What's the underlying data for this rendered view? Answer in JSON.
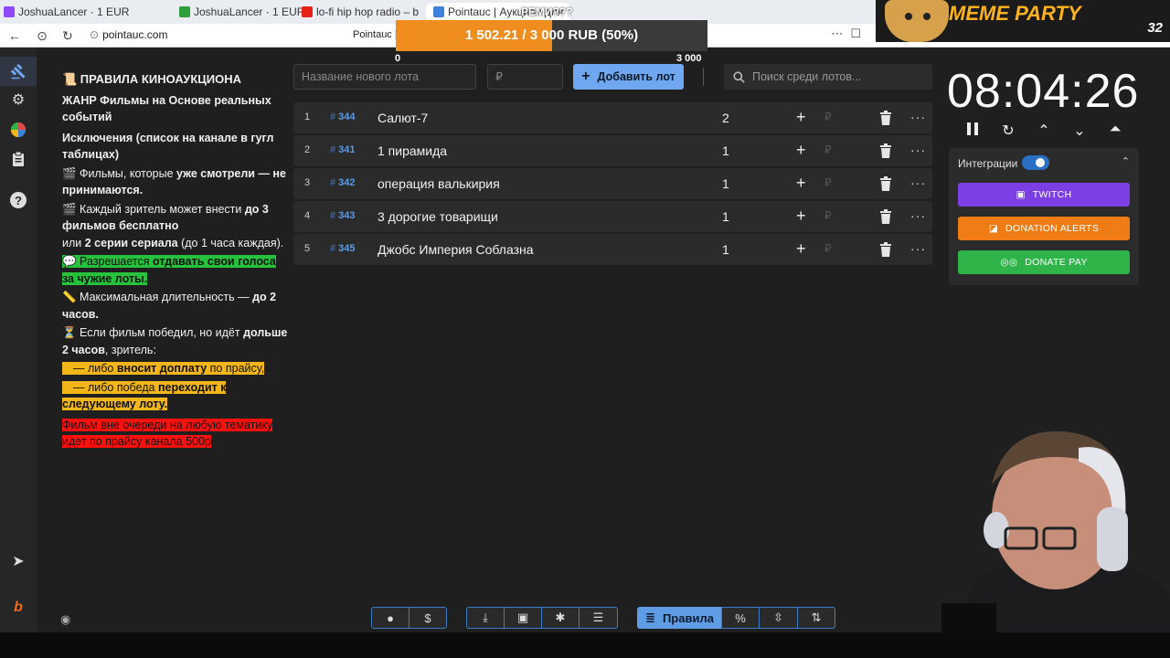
{
  "browser": {
    "tabs": [
      {
        "label": "JoshuaLancer · 1 EUR"
      },
      {
        "label": "JoshuaLancer · 1 EUR"
      },
      {
        "label": "lo-fi hip hop radio – b"
      },
      {
        "label": "Pointauc | Аукцион для"
      }
    ],
    "url": "pointauc.com",
    "page_title": "Pointauc |"
  },
  "overlay": {
    "progress_text": "1 502.21 / 3 000 RUB (50%)",
    "progress_fraction": 0.5,
    "min_label": "0",
    "max_label": "3 000",
    "meme_title": "MEME PARTY",
    "meme_number": "32",
    "overlay_text": "РЕМИ???"
  },
  "rules": {
    "title": "📜 ПРАВИЛА КИНОАУКЦИОНА",
    "genre": "ЖАНР Фильмы на Основе реальных событий",
    "exceptions": "Исключения (список на канале в гугл таблицах)",
    "l1a": "🎬 Фильмы, которые ",
    "l1b": "уже смотрели — не принимаются.",
    "l2a": "🎬 Каждый зритель может внести ",
    "l2b": "до 3 фильмов бесплатно",
    "l2c": "или ",
    "l2d": "2 серии сериала",
    "l2e": " (до 1 часа каждая).",
    "l3a": "💬 Разрешается ",
    "l3b": "отдавать свои голоса за чужие лоты.",
    "l4a": "📏 Максимальная длительность — ",
    "l4b": "до 2 часов.",
    "l5a": "⏳ Если фильм победил, но идёт ",
    "l5b": "дольше 2 часов",
    "l5c": ", зритель:",
    "l6a": "— либо ",
    "l6b": "вносит доплату",
    "l6c": " по прайсу,",
    "l7a": "— либо победа ",
    "l7b": "переходит к следующему лоту.",
    "red": "Фильм вне очереди на любую тематику идет по прайсу канала 500р"
  },
  "controls": {
    "new_lot_placeholder": "Название нового лота",
    "amount_placeholder": "₽",
    "add_lot_label": "Добавить лот",
    "search_placeholder": "Поиск среди лотов..."
  },
  "lots": [
    {
      "index": "1",
      "number": "344",
      "name": "Салют-7",
      "amount": "2"
    },
    {
      "index": "2",
      "number": "341",
      "name": "1 пирамида",
      "amount": "1"
    },
    {
      "index": "3",
      "number": "342",
      "name": "операция валькирия",
      "amount": "1"
    },
    {
      "index": "4",
      "number": "343",
      "name": "3 дорогие товарищи",
      "amount": "1"
    },
    {
      "index": "5",
      "number": "345",
      "name": "Джобс Империя Соблазна",
      "amount": "1"
    }
  ],
  "lot_actions": {
    "plus": "+",
    "rub": "₽",
    "more": "···"
  },
  "timer": {
    "value": "08:04:26"
  },
  "integrations": {
    "title": "Интеграции",
    "twitch": "TWITCH",
    "donation_alerts": "DONATION ALERTS",
    "donate_pay": "DONATE PAY",
    "colors": {
      "twitch": "#7b3fe4",
      "donation_alerts": "#f07c16",
      "donate_pay": "#2fb44a"
    }
  },
  "bottom_toolbar": {
    "rules_label": "Правила",
    "percent": "%"
  }
}
